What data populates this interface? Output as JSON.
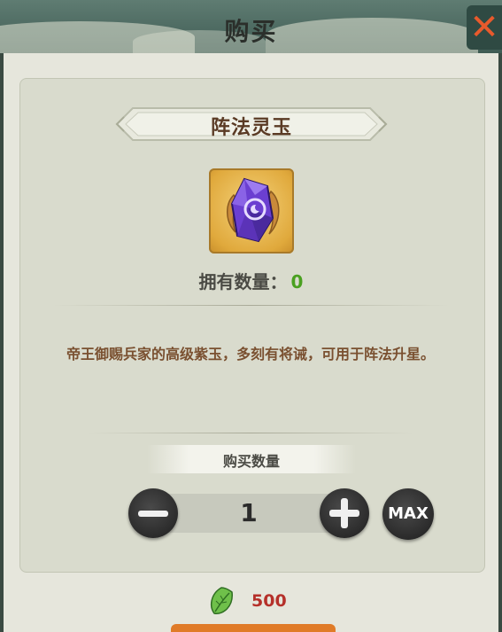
{
  "header": {
    "title": "购买",
    "close_icon": "close-icon"
  },
  "item": {
    "name": "阵法灵玉",
    "icon": "purple-jade-icon",
    "owned_label": "拥有数量：",
    "owned_value": "0",
    "description": "帝王御赐兵家的高级紫玉，多刻有将诫，可用于阵法升星。"
  },
  "purchase": {
    "quantity_label": "购买数量",
    "quantity": "1",
    "minus_icon": "minus-icon",
    "plus_icon": "plus-icon",
    "max_label": "MAX",
    "price": "500",
    "currency_icon": "green-leaf-icon"
  },
  "colors": {
    "header_bg": "#4f6c64",
    "panel_bg": "#d9dbcd",
    "description_text": "#7a5030",
    "owned_value": "#4aa020",
    "price_text": "#b5302a",
    "close_accent": "#e85a2c"
  }
}
